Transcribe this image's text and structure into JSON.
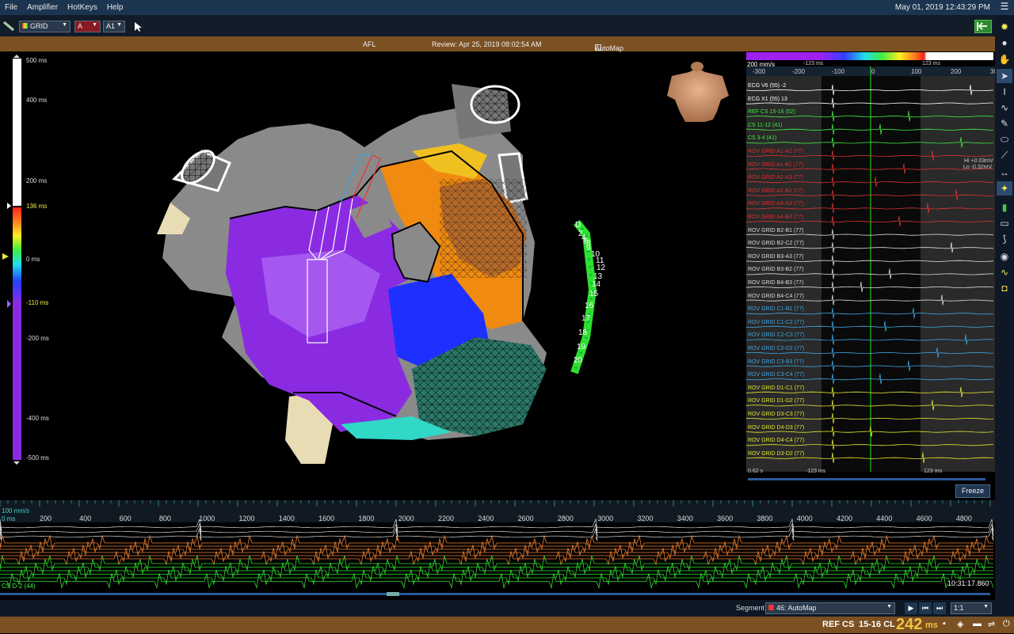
{
  "menu": {
    "items": [
      "File",
      "Amplifier",
      "HotKeys",
      "Help"
    ],
    "datetime": "May 01, 2019 12:43:29 PM"
  },
  "toolbar": {
    "map_type": "GRID",
    "channel_a": "A",
    "channel_a1": "A1"
  },
  "status": {
    "rhythm": "AFL",
    "review": "Review: Apr 25, 2019 08:02:54 AM",
    "automap": "AutoMap"
  },
  "scale": {
    "ticks": [
      "500 ms",
      "400 ms",
      "200 ms",
      "136 ms",
      "0 ms",
      "-110 ms",
      "-200 ms",
      "-400 ms",
      "-500 ms"
    ]
  },
  "colors": {
    "accent": "#7b5022",
    "menubar": "#1b3550",
    "purple": "#8a2be2",
    "green": "#2ee02e"
  },
  "egm": {
    "speed": "200 mm/s",
    "ref_left": "-123 ms",
    "ref_right": "123 ms",
    "axis": [
      "-300",
      "-200",
      "-100",
      "0",
      "100",
      "200",
      "300"
    ],
    "hi": "Hi +0.03mV",
    "lo": "Lo -0.32mV",
    "footer_left": "0.62 s",
    "footer_mid": "-123 ms",
    "footer_right": "123 ms",
    "freeze": "Freeze",
    "channels": [
      {
        "label": "ECG V6 (55) -2",
        "color": "#ffffff"
      },
      {
        "label": "ECG X1 (55) 13",
        "color": "#ffffff"
      },
      {
        "label": "REF CS 15-16 (52)",
        "color": "#44ee44"
      },
      {
        "label": "CS 11-12 (41)",
        "color": "#44ee44"
      },
      {
        "label": "CS 3-4 (41)",
        "color": "#44ee44"
      },
      {
        "label": "ROV GRID A1-A2 (77)",
        "color": "#dd3333"
      },
      {
        "label": "ROV GRID A1-B1 (77)",
        "color": "#dd3333"
      },
      {
        "label": "ROV GRID A2-A3 (77)",
        "color": "#dd3333"
      },
      {
        "label": "ROV GRID A2-B2 (77)",
        "color": "#dd3333"
      },
      {
        "label": "ROV GRID A4-A3 (77)",
        "color": "#dd3333"
      },
      {
        "label": "ROV GRID A4-B4 (77)",
        "color": "#dd3333"
      },
      {
        "label": "ROV GRID B2-B1 (77)",
        "color": "#dddddd"
      },
      {
        "label": "ROV GRID B2-C2 (77)",
        "color": "#dddddd"
      },
      {
        "label": "ROV GRID B3-A3 (77)",
        "color": "#dddddd"
      },
      {
        "label": "ROV GRID B3-B2 (77)",
        "color": "#dddddd"
      },
      {
        "label": "ROV GRID B4-B3 (77)",
        "color": "#dddddd"
      },
      {
        "label": "ROV GRID B4-C4 (77)",
        "color": "#dddddd"
      },
      {
        "label": "ROV GRID C1-B1 (77)",
        "color": "#3fa8e6"
      },
      {
        "label": "ROV GRID C1-C2 (77)",
        "color": "#3fa8e6"
      },
      {
        "label": "ROV GRID C2-C3 (77)",
        "color": "#3fa8e6"
      },
      {
        "label": "ROV GRID C2-D2 (77)",
        "color": "#3fa8e6"
      },
      {
        "label": "ROV GRID C3-B3 (77)",
        "color": "#3fa8e6"
      },
      {
        "label": "ROV GRID C3-C4 (77)",
        "color": "#3fa8e6"
      },
      {
        "label": "ROV GRID D1-C1 (77)",
        "color": "#e6e632"
      },
      {
        "label": "ROV GRID D1-D2 (77)",
        "color": "#e6e632"
      },
      {
        "label": "ROV GRID D3-C3 (77)",
        "color": "#e6e632"
      },
      {
        "label": "ROV GRID D4-D3 (77)",
        "color": "#e6e632"
      },
      {
        "label": "ROV GRID D4-C4 (77)",
        "color": "#e6e632"
      },
      {
        "label": "ROV GRID D3-D2 (77)",
        "color": "#e6e632"
      }
    ]
  },
  "catheter": {
    "labels": [
      "D",
      "2",
      "4",
      "6",
      "8",
      "9",
      "10",
      "11",
      "12",
      "13",
      "14",
      "15",
      "16",
      "17",
      "18",
      "19",
      "20"
    ]
  },
  "timeline": {
    "speed": "100 mm/s",
    "zero": "0 ms",
    "ticks": [
      "200",
      "400",
      "600",
      "800",
      "1000",
      "1200",
      "1400",
      "1600",
      "1800",
      "2000",
      "2200",
      "2400",
      "2600",
      "2800",
      "3000",
      "3200",
      "3400",
      "3600",
      "3800",
      "4000",
      "4200",
      "4400",
      "4600",
      "4800"
    ],
    "cs_label": "CS  D-2 (44)",
    "time": "10:31:17.860"
  },
  "segment": {
    "label": "Segment",
    "value": "46: AutoMap",
    "ratio": "1:1"
  },
  "footer": {
    "ref": "REF CS",
    "channel": "15-16 CL",
    "cl": "242",
    "unit": "ms"
  }
}
